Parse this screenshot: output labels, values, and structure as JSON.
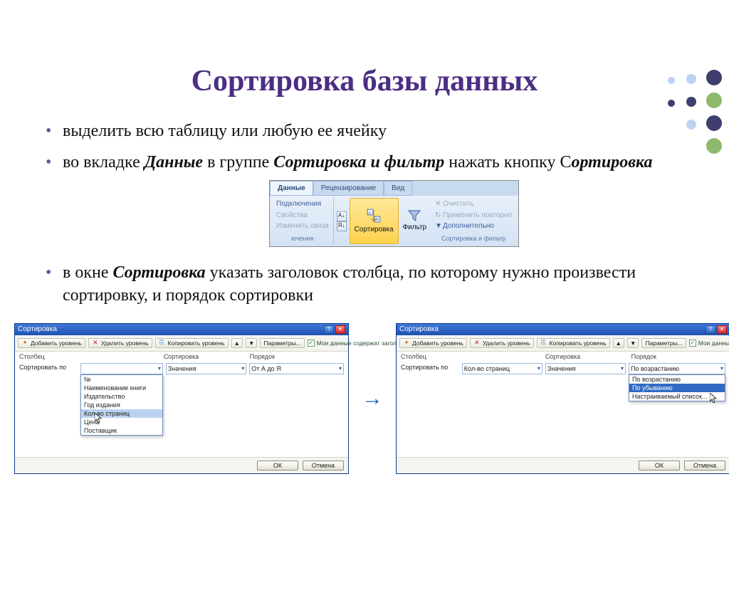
{
  "title": "Сортировка базы данных",
  "bullets": {
    "b1": "выделить всю таблицу или любую ее ячейку",
    "b2_pre": "во вкладке ",
    "b2_tab": "Данные",
    "b2_mid": " в группе ",
    "b2_group": "Сортировка и фильтр",
    "b2_mid2": " нажать кнопку С",
    "b2_btn": "ортировка",
    "b3_pre": "в окне ",
    "b3_win": "Сортировка",
    "b3_post": " указать заголовок столбца, по которому нужно произвести сортировку, и порядок сортировки"
  },
  "ribbon": {
    "tabs": {
      "data": "Данные",
      "review": "Рецензирование",
      "view": "Вид"
    },
    "links": {
      "conn": "Подключения",
      "props": "Свойства",
      "editlinks": "Изменить связи",
      "partial": "ючения"
    },
    "sort_btn": "Сортировка",
    "filter_btn": "Фильтр",
    "clear": "Очистить",
    "reapply": "Применить повторно",
    "advanced": "Дополнительно",
    "group_label": "Сортировка и фильтр"
  },
  "dialog": {
    "title": "Сортировка",
    "add_level": "Добавить уровень",
    "del_level": "Удалить уровень",
    "copy_level": "Копировать уровень",
    "params": "Параметры...",
    "my_data": "Мои данные содержат заголовки",
    "col_header": "Столбец",
    "sort_header": "Сортировка",
    "order_header": "Порядок",
    "sort_by": "Сортировать по",
    "values": "Значения",
    "order_az": "От А до Я",
    "order_asc": "По возрастанию",
    "order_desc": "По убыванию",
    "order_custom": "Настраиваемый список...",
    "ok": "ОК",
    "cancel": "Отмена",
    "field_selected": "Кол-во страниц",
    "dd_items": [
      "№",
      "Наименование книги",
      "Издательство",
      "Год издания",
      "Кол-во страниц",
      "Цена",
      "Поставщик"
    ]
  }
}
